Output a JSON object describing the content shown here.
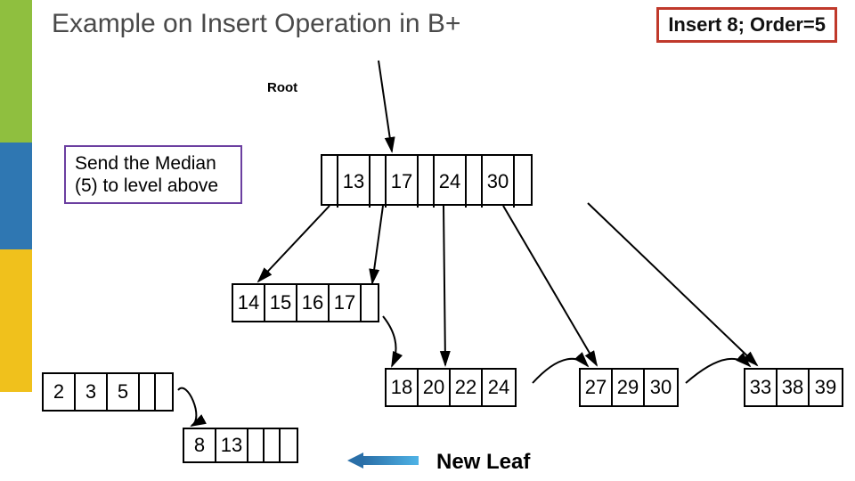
{
  "title": "Example on Insert Operation in B+",
  "insert_box": "Insert 8; Order=5",
  "root_label": "Root",
  "callout": "Send the Median (5) to level above",
  "new_leaf_label": "New Leaf",
  "nodes": {
    "root": {
      "cells": [
        "",
        "13",
        "",
        "17",
        "",
        "24",
        "",
        "30",
        ""
      ]
    },
    "n14": {
      "cells": [
        "14",
        "15",
        "16",
        "17",
        ""
      ]
    },
    "n2": {
      "cells": [
        "2",
        "3",
        "5",
        "",
        ""
      ]
    },
    "n8": {
      "cells": [
        "8",
        "13",
        "",
        "",
        ""
      ]
    },
    "n18": {
      "cells": [
        "18",
        "20",
        "22",
        "24"
      ]
    },
    "n27": {
      "cells": [
        "27",
        "29",
        "30"
      ]
    },
    "n33": {
      "cells": [
        "33",
        "38",
        "39"
      ]
    }
  }
}
